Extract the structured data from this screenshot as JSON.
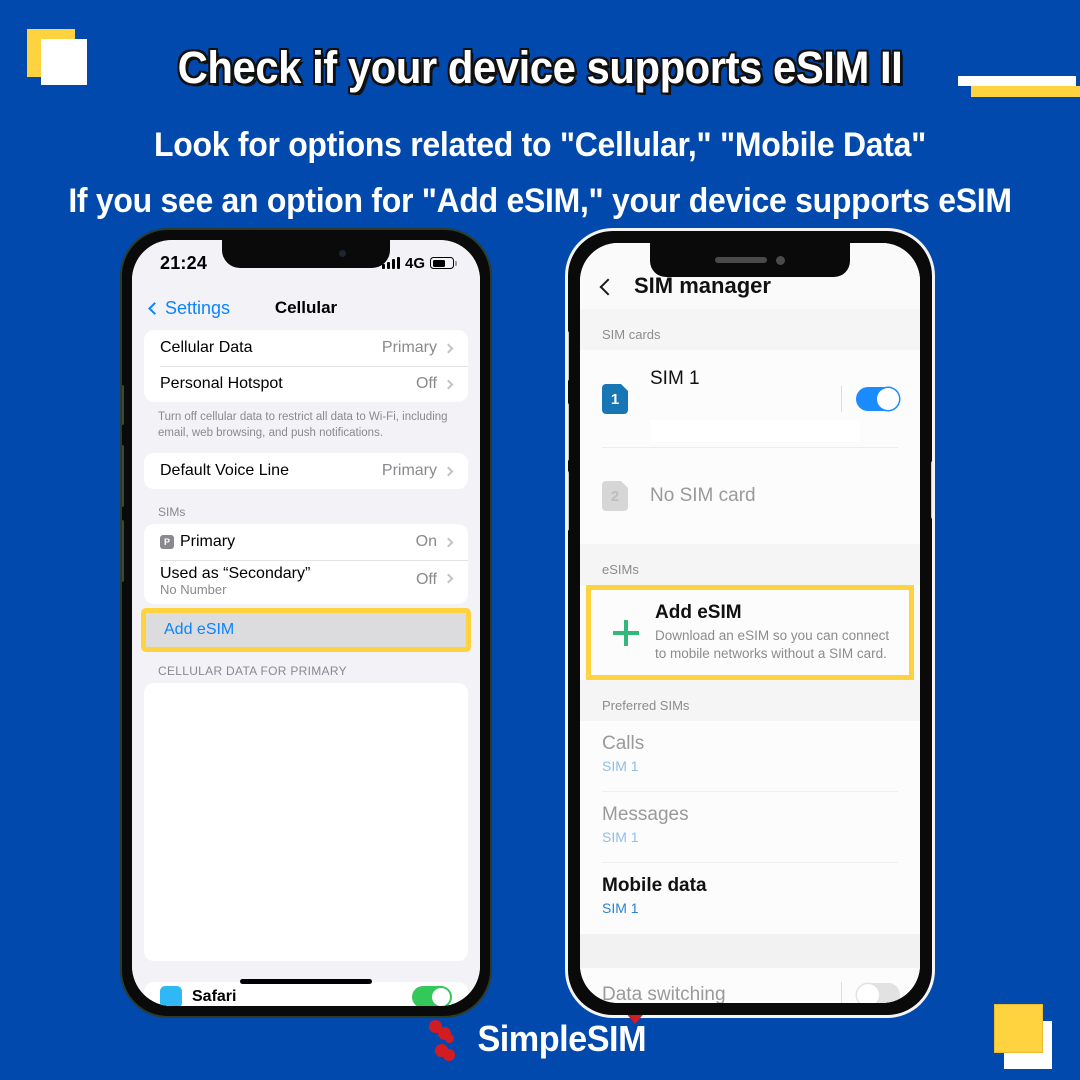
{
  "headline": "Check if your device supports eSIM II",
  "sublines": [
    "Look for options related to \"Cellular,\" \"Mobile Data\"",
    "If you see an option for \"Add eSIM,\"  your device supports eSIM"
  ],
  "colors": {
    "background": "#0249AE",
    "accent_yellow": "#FFD23F",
    "ios_blue": "#0A84FF",
    "android_blue": "#1A8CFF",
    "logo_red": "#D31B22",
    "toggle_green": "#34C759",
    "plus_green": "#34B87A"
  },
  "ios_phone": {
    "status_bar": {
      "time": "21:24",
      "network": "4G",
      "signal_icon": "signal-bars-icon",
      "battery_icon": "battery-icon"
    },
    "nav": {
      "back_label": "Settings",
      "back_icon": "chevron-left-icon",
      "title": "Cellular"
    },
    "group_1": [
      {
        "label": "Cellular Data",
        "value": "Primary",
        "chevron": "chevron-right-icon"
      },
      {
        "label": "Personal Hotspot",
        "value": "Off",
        "chevron": "chevron-right-icon"
      }
    ],
    "footnote": "Turn off cellular data to restrict all data to Wi-Fi, including email, web browsing, and push notifications.",
    "group_2": [
      {
        "label": "Default Voice Line",
        "value": "Primary",
        "chevron": "chevron-right-icon"
      }
    ],
    "sims_header": "SIMs",
    "sims": [
      {
        "badge": "P",
        "label": "Primary",
        "sub": "",
        "value": "On",
        "chevron": "chevron-right-icon"
      },
      {
        "badge": "",
        "label": "Used as “Secondary”",
        "sub": "No Number",
        "value": "Off",
        "chevron": "chevron-right-icon"
      }
    ],
    "add_esim_label": "Add eSIM",
    "data_header": "CELLULAR DATA FOR PRIMARY",
    "safari": {
      "label": "Safari",
      "icon": "safari-icon",
      "toggle": "on"
    }
  },
  "android_phone": {
    "nav": {
      "back_icon": "chevron-left-icon",
      "title": "SIM manager"
    },
    "sim_cards_header": "SIM cards",
    "sim_cards": [
      {
        "chip": "1",
        "name": "SIM 1",
        "toggle": "on",
        "redacted": true
      },
      {
        "chip": "2",
        "name": "No SIM card",
        "toggle": "",
        "redacted": false
      }
    ],
    "esims_header": "eSIMs",
    "add_esim": {
      "icon": "plus-icon",
      "title": "Add eSIM",
      "description": "Download an eSIM so you can connect to mobile networks without a SIM card."
    },
    "preferred_header": "Preferred SIMs",
    "preferred": [
      {
        "label": "Calls",
        "value": "SIM 1",
        "active": false
      },
      {
        "label": "Messages",
        "value": "SIM 1",
        "active": false
      },
      {
        "label": "Mobile data",
        "value": "SIM 1",
        "active": true
      }
    ],
    "data_switching": {
      "label": "Data switching",
      "toggle": "off"
    }
  },
  "footer": {
    "brand": "SimpleSIM",
    "mark": "simplesim-logo-icon"
  }
}
